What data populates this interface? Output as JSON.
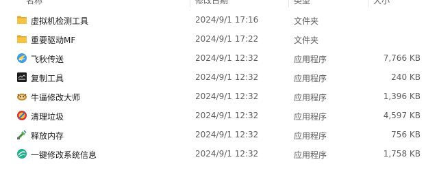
{
  "columns": {
    "name": "名称",
    "date": "修改日期",
    "type": "类型",
    "size": "大小"
  },
  "files": [
    {
      "name": "虚拟机检测工具",
      "date": "2024/9/1 17:16",
      "type": "文件夹",
      "size": "",
      "icon": "folder-icon"
    },
    {
      "name": "重要驱动MF",
      "date": "2024/9/1 17:22",
      "type": "文件夹",
      "size": "",
      "icon": "folder-icon"
    },
    {
      "name": "飞秋传送",
      "date": "2024/9/1 12:32",
      "type": "应用程序",
      "size": "7,766 KB",
      "icon": "feiqiu-app-icon"
    },
    {
      "name": "复制工具",
      "date": "2024/9/1 12:32",
      "type": "应用程序",
      "size": "240 KB",
      "icon": "copy-tool-app-icon"
    },
    {
      "name": "牛逼修改大师",
      "date": "2024/9/1 12:32",
      "type": "应用程序",
      "size": "1,396 KB",
      "icon": "modify-master-app-icon"
    },
    {
      "name": "清理垃圾",
      "date": "2024/9/1 12:32",
      "type": "应用程序",
      "size": "4,597 KB",
      "icon": "cleanup-app-icon"
    },
    {
      "name": "释放内存",
      "date": "2024/9/1 12:32",
      "type": "应用程序",
      "size": "756 KB",
      "icon": "memory-release-app-icon"
    },
    {
      "name": "一键修改系统信息",
      "date": "2024/9/1 12:32",
      "type": "应用程序",
      "size": "1,758 KB",
      "icon": "system-info-app-icon"
    }
  ],
  "colors": {
    "folder": "#f5c342",
    "folder_dark": "#e0a82e"
  }
}
